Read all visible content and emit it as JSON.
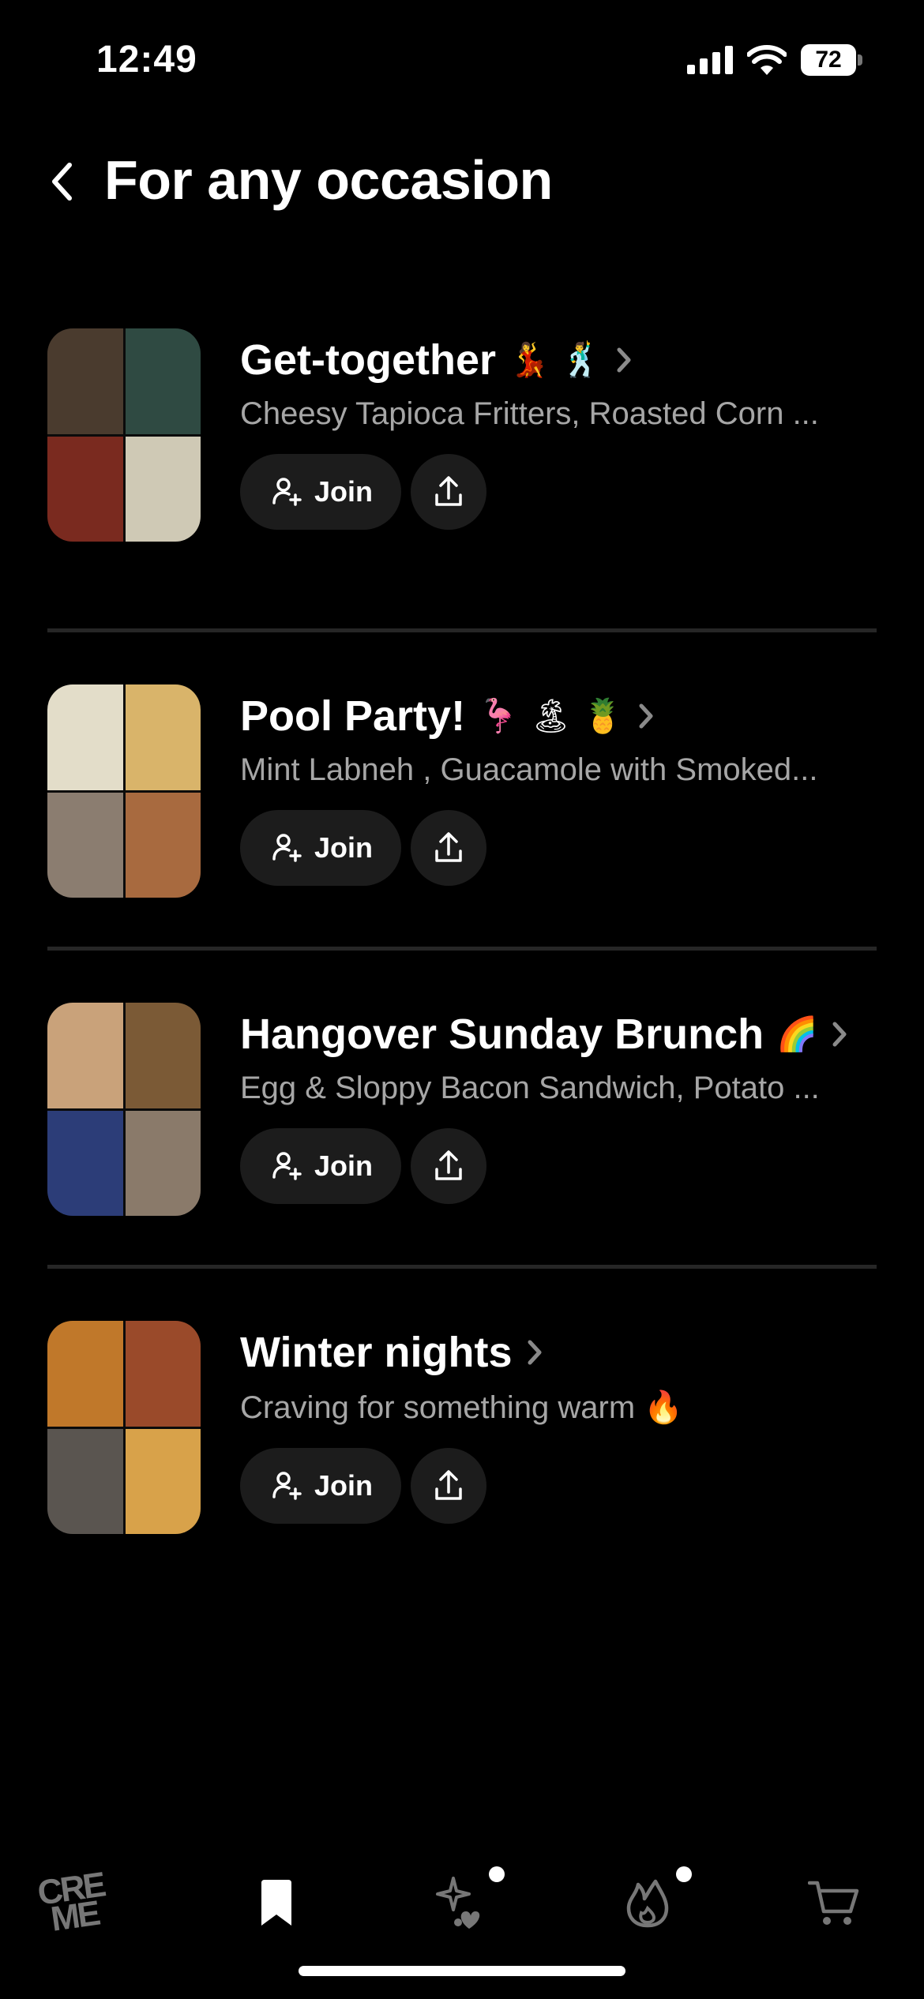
{
  "status_bar": {
    "time": "12:49",
    "battery": "72"
  },
  "header": {
    "title": "For any occasion"
  },
  "occasions": [
    {
      "title": "Get-together",
      "emoji": "💃 🕺",
      "subtitle": "Cheesy Tapioca Fritters, Roasted Corn ...",
      "join_label": "Join",
      "thumb_colors": [
        "#4a3b2e",
        "#2f4a42",
        "#7a2a1f",
        "#cfc9b5"
      ]
    },
    {
      "title": "Pool Party!",
      "emoji": "🦩 🏝 🍍",
      "subtitle": "Mint Labneh , Guacamole with Smoked...",
      "join_label": "Join",
      "thumb_colors": [
        "#e3ddc9",
        "#d9b46a",
        "#8b7d70",
        "#a86a3f"
      ]
    },
    {
      "title": "Hangover Sunday Brunch",
      "emoji": "🌈",
      "subtitle": "Egg & Sloppy Bacon Sandwich, Potato ...",
      "join_label": "Join",
      "thumb_colors": [
        "#c9a27a",
        "#7b5a36",
        "#2c3d78",
        "#8a7a6a"
      ]
    },
    {
      "title": "Winter nights",
      "emoji": "",
      "subtitle": "Craving for something warm 🔥",
      "join_label": "Join",
      "thumb_colors": [
        "#c0782a",
        "#9a4a2a",
        "#5a5550",
        "#d8a24a"
      ]
    }
  ],
  "tabbar": {
    "logo_text": "CRE ME"
  },
  "colors": {
    "background": "#000000",
    "card_button": "#1c1c1c",
    "divider": "#262626",
    "subtitle": "#a6a6a6"
  }
}
